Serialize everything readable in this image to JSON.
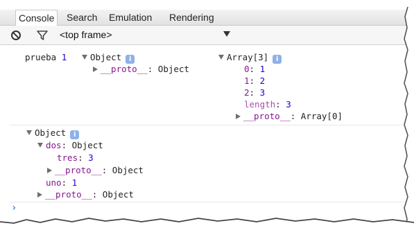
{
  "tabs": [
    "Console",
    "Search",
    "Emulation",
    "Rendering"
  ],
  "toolbar": {
    "frame_selector": "<top frame>"
  },
  "icons": {
    "clear": "no-entry-icon",
    "filter": "funnel-icon",
    "info": "info-badge-icon",
    "prompt": "chevron-right-icon"
  },
  "colors": {
    "property": "#881391",
    "number": "#1c00cf",
    "info_badge": "#8fb1e8",
    "prompt": "#367cf1"
  },
  "log1": {
    "label": "prueba",
    "number": "1",
    "object_label": "Object",
    "proto_key": "__proto__",
    "proto_sep": ": ",
    "proto_val": "Object",
    "array_label": "Array[3]",
    "items": [
      {
        "key": "0",
        "sep": ": ",
        "val": "1"
      },
      {
        "key": "1",
        "sep": ": ",
        "val": "2"
      },
      {
        "key": "2",
        "sep": ": ",
        "val": "3"
      },
      {
        "key": "length",
        "sep": ": ",
        "val": "3"
      }
    ],
    "array_proto_key": "__proto__",
    "array_proto_sep": ": ",
    "array_proto_val": "Array[0]"
  },
  "log2": {
    "object_label": "Object",
    "dos_key": "dos",
    "dos_sep": ": ",
    "dos_val": "Object",
    "tres_key": "tres",
    "tres_sep": ": ",
    "tres_val": "3",
    "dos_proto_key": "__proto__",
    "dos_proto_sep": ": ",
    "dos_proto_val": "Object",
    "uno_key": "uno",
    "uno_sep": ": ",
    "uno_val": "1",
    "proto_key": "__proto__",
    "proto_sep": ": ",
    "proto_val": "Object"
  },
  "info_glyph": "i",
  "prompt_glyph": "›"
}
